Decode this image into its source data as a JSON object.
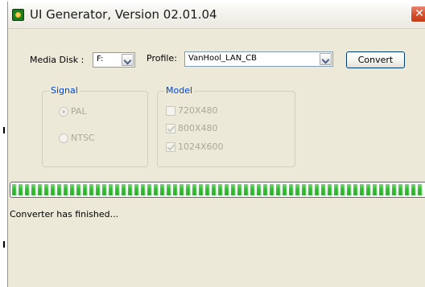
{
  "window": {
    "title": "UI Generator, Version 02.01.04",
    "close_glyph": "✕"
  },
  "media_disk": {
    "label": "Media Disk :",
    "value": "F:"
  },
  "profile": {
    "label": "Profile:",
    "value": "VanHool_LAN_CB"
  },
  "convert_button": {
    "label": "Convert"
  },
  "signal": {
    "title": "Signal",
    "options": [
      {
        "label": "PAL",
        "checked": true
      },
      {
        "label": "NTSC",
        "checked": false
      }
    ]
  },
  "model": {
    "title": "Model",
    "options": [
      {
        "label": "720X480",
        "checked": false
      },
      {
        "label": "800X480",
        "checked": true
      },
      {
        "label": "1024X600",
        "checked": true
      }
    ]
  },
  "progress": {
    "fraction": 1.0
  },
  "status": {
    "text": "Converter has finished..."
  },
  "icons": {
    "app": "app-icon",
    "close": "close-icon",
    "dropdown": "chevron-down-icon"
  },
  "colors": {
    "window_bg": "#ece9d8",
    "group_title": "#0046d5",
    "progress_green": "#37c837",
    "close_red": "#d9512f",
    "disabled_text": "#aca899"
  }
}
